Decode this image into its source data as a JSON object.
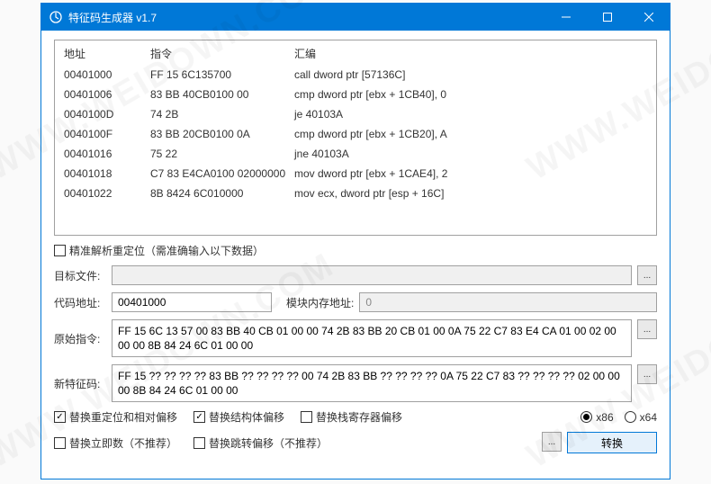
{
  "titlebar": {
    "title": "特征码生成器 v1.7"
  },
  "table": {
    "headers": {
      "addr": "地址",
      "instr": "指令",
      "asm": "汇编"
    },
    "rows": [
      {
        "addr": "00401000",
        "instr": "FF 15 6C135700",
        "asm": "call dword ptr [57136C]"
      },
      {
        "addr": "00401006",
        "instr": "83 BB 40CB0100 00",
        "asm": "cmp dword ptr [ebx + 1CB40], 0"
      },
      {
        "addr": "0040100D",
        "instr": "74 2B",
        "asm": "je 40103A"
      },
      {
        "addr": "0040100F",
        "instr": "83 BB 20CB0100 0A",
        "asm": "cmp dword ptr [ebx + 1CB20], A"
      },
      {
        "addr": "00401016",
        "instr": "75 22",
        "asm": "jne 40103A"
      },
      {
        "addr": "00401018",
        "instr": "C7 83 E4CA0100 02000000",
        "asm": "mov dword ptr [ebx + 1CAE4], 2"
      },
      {
        "addr": "00401022",
        "instr": "8B 8424 6C010000",
        "asm": "mov ecx, dword ptr [esp + 16C]"
      }
    ]
  },
  "precise": {
    "label": "精准解析重定位（需准确输入以下数据）",
    "checked": false
  },
  "targetFile": {
    "label": "目标文件:",
    "value": ""
  },
  "codeAddr": {
    "label": "代码地址:",
    "value": "00401000"
  },
  "modAddr": {
    "label": "模块内存地址:",
    "value": "0"
  },
  "origInstr": {
    "label": "原始指令:",
    "value": "FF 15 6C 13 57 00 83 BB 40 CB 01 00 00 74 2B 83 BB 20 CB 01 00 0A 75 22 C7 83 E4 CA 01 00 02 00 00 00 8B 84 24 6C 01 00 00"
  },
  "newSig": {
    "label": "新特征码:",
    "value": "FF 15 ?? ?? ?? ?? 83 BB ?? ?? ?? ?? 00 74 2B 83 BB ?? ?? ?? ?? 0A 75 22 C7 83 ?? ?? ?? ?? 02 00 00 00 8B 84 24 6C 01 00 00"
  },
  "opts": {
    "reloc": {
      "label": "替换重定位和相对偏移",
      "checked": true
    },
    "struct": {
      "label": "替换结构体偏移",
      "checked": true
    },
    "stack": {
      "label": "替换栈寄存器偏移",
      "checked": false
    },
    "imm": {
      "label": "替换立即数（不推荐）",
      "checked": false
    },
    "jmp": {
      "label": "替换跳转偏移（不推荐）",
      "checked": false
    }
  },
  "arch": {
    "x86": "x86",
    "x64": "x64",
    "selected": "x86"
  },
  "convert": "转换",
  "watermark": "WWW.WEIDOWN.COM"
}
